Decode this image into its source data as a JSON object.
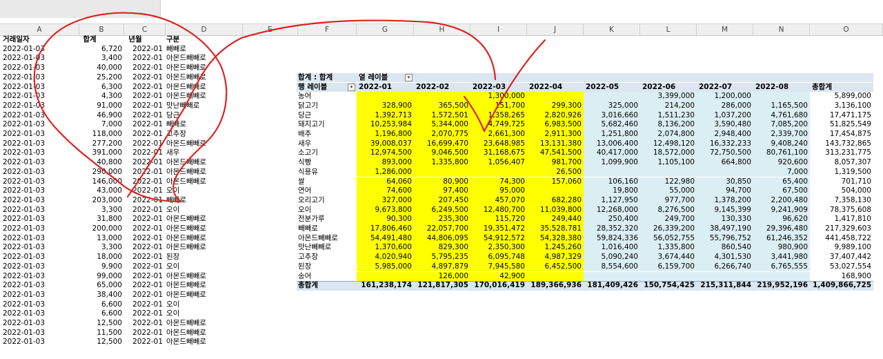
{
  "columns": [
    "A",
    "B",
    "C",
    "D",
    "E",
    "F",
    "G",
    "H",
    "I",
    "J",
    "K",
    "L",
    "M",
    "N",
    "O"
  ],
  "source": {
    "headers": [
      "거래일자",
      "합계",
      "년월",
      "구분"
    ],
    "rows": [
      [
        "2022-01-03",
        "6,720",
        "2022-01",
        "빼빼로"
      ],
      [
        "2022-01-03",
        "3,400",
        "2022-01",
        "아몬드빼빼로"
      ],
      [
        "2022-01-03",
        "40,000",
        "2022-01",
        "아몬드빼빼로"
      ],
      [
        "2022-01-03",
        "25,200",
        "2022-01",
        "아몬드빼빼로"
      ],
      [
        "2022-01-03",
        "6,300",
        "2022-01",
        "아몬드빼빼로"
      ],
      [
        "2022-01-03",
        "4,300",
        "2022-01",
        "아몬드빼빼로"
      ],
      [
        "2022-01-03",
        "91,000",
        "2022-01",
        "맛난빼빼로"
      ],
      [
        "2022-01-03",
        "46,900",
        "2022-01",
        "당근"
      ],
      [
        "2022-01-03",
        "7,000",
        "2022-01",
        "빼빼로"
      ],
      [
        "2022-01-03",
        "118,000",
        "2022-01",
        "고추장"
      ],
      [
        "2022-01-03",
        "277,200",
        "2022-01",
        "아몬드빼빼로"
      ],
      [
        "2022-01-03",
        "391,000",
        "2022-01",
        "새우"
      ],
      [
        "2022-01-03",
        "40,800",
        "2022-01",
        "아몬드빼빼로"
      ],
      [
        "2022-01-03",
        "290,000",
        "2022-01",
        "아몬드빼빼로"
      ],
      [
        "2022-01-03",
        "146,000",
        "2022-01",
        "아몬드빼빼로"
      ],
      [
        "2022-01-03",
        "43,000",
        "2022-01",
        "오이"
      ],
      [
        "2022-01-03",
        "203,000",
        "2022-01",
        "빼빼로"
      ],
      [
        "2022-01-03",
        "3,300",
        "2022-01",
        "오이"
      ],
      [
        "2022-01-03",
        "31,800",
        "2022-01",
        "아몬드빼빼로"
      ],
      [
        "2022-01-03",
        "200,000",
        "2022-01",
        "아몬드빼빼로"
      ],
      [
        "2022-01-03",
        "13,000",
        "2022-01",
        "아몬드빼빼로"
      ],
      [
        "2022-01-03",
        "3,300",
        "2022-01",
        "아몬드빼빼로"
      ],
      [
        "2022-01-03",
        "18,000",
        "2022-01",
        "된장"
      ],
      [
        "2022-01-03",
        "9,900",
        "2022-01",
        "오이"
      ],
      [
        "2022-01-03",
        "99,000",
        "2022-01",
        "아몬드빼빼로"
      ],
      [
        "2022-01-03",
        "65,000",
        "2022-01",
        "아몬드빼빼로"
      ],
      [
        "2022-01-03",
        "38,400",
        "2022-01",
        "아몬드빼빼로"
      ],
      [
        "2022-01-03",
        "6,600",
        "2022-01",
        "오이"
      ],
      [
        "2022-01-03",
        "6,600",
        "2022-01",
        "오이"
      ],
      [
        "2022-01-03",
        "12,500",
        "2022-01",
        "아몬드빼빼로"
      ],
      [
        "2022-01-03",
        "11,500",
        "2022-01",
        "아몬드빼빼로"
      ],
      [
        "2022-01-03",
        "12,500",
        "2022-01",
        "아몬드빼빼로"
      ]
    ]
  },
  "pivot": {
    "value_label": "합계 : 합계",
    "column_label": "열 레이블",
    "row_label": "행 레이블",
    "months": [
      "2022-01",
      "2022-02",
      "2022-03",
      "2022-04",
      "2022-05",
      "2022-06",
      "2022-07",
      "2022-08"
    ],
    "total_label": "총합계",
    "rows": [
      {
        "name": "농어",
        "values": [
          "",
          "",
          "1,300,000",
          "",
          "",
          "3,399,000",
          "1,200,000",
          ""
        ],
        "total": "5,899,000"
      },
      {
        "name": "닭고기",
        "values": [
          "328,900",
          "365,500",
          "151,700",
          "299,300",
          "325,000",
          "214,200",
          "286,000",
          "1,165,500"
        ],
        "total": "3,136,100"
      },
      {
        "name": "당근",
        "values": [
          "1,392,713",
          "1,572,501",
          "1,358,265",
          "2,820,926",
          "3,016,660",
          "1,511,230",
          "1,037,200",
          "4,761,680"
        ],
        "total": "17,471,175"
      },
      {
        "name": "돼지고기",
        "values": [
          "10,253,984",
          "5,344,000",
          "4,749,725",
          "6,983,500",
          "5,682,460",
          "8,136,200",
          "3,590,480",
          "7,085,200"
        ],
        "total": "51,825,549"
      },
      {
        "name": "배추",
        "values": [
          "1,196,800",
          "2,070,775",
          "2,661,300",
          "2,911,300",
          "1,251,800",
          "2,074,800",
          "2,948,400",
          "2,339,700"
        ],
        "total": "17,454,875"
      },
      {
        "name": "새우",
        "values": [
          "39,008,037",
          "16,699,470",
          "23,648,985",
          "13,131,380",
          "13,006,400",
          "12,498,120",
          "16,332,233",
          "9,408,240"
        ],
        "total": "143,732,865"
      },
      {
        "name": "소고기",
        "values": [
          "12,974,500",
          "9,046,500",
          "31,168,675",
          "47,541,500",
          "40,417,000",
          "18,572,000",
          "72,750,500",
          "80,761,100"
        ],
        "total": "313,231,775"
      },
      {
        "name": "식빵",
        "values": [
          "893,000",
          "1,335,800",
          "1,056,407",
          "981,700",
          "1,099,900",
          "1,105,100",
          "664,800",
          "920,600"
        ],
        "total": "8,057,307"
      },
      {
        "name": "식용유",
        "values": [
          "1,286,000",
          "",
          "",
          "26,500",
          "",
          "",
          "",
          "7,000"
        ],
        "total": "1,319,500"
      },
      {
        "name": "쌀",
        "values": [
          "64,060",
          "80,900",
          "74,300",
          "157,060",
          "106,160",
          "122,980",
          "30,850",
          "65,400"
        ],
        "total": "701,710"
      },
      {
        "name": "연어",
        "values": [
          "74,600",
          "97,400",
          "95,000",
          "",
          "19,800",
          "55,000",
          "94,700",
          "67,500"
        ],
        "total": "504,000"
      },
      {
        "name": "오리고기",
        "values": [
          "327,000",
          "207,450",
          "457,070",
          "682,280",
          "1,127,950",
          "977,700",
          "1,378,200",
          "2,200,480"
        ],
        "total": "7,358,130"
      },
      {
        "name": "오이",
        "values": [
          "9,673,800",
          "6,249,500",
          "12,480,700",
          "11,039,800",
          "12,268,000",
          "8,276,500",
          "9,145,399",
          "9,241,909"
        ],
        "total": "78,375,608"
      },
      {
        "name": "전분가루",
        "values": [
          "90,300",
          "235,300",
          "115,720",
          "249,440",
          "250,400",
          "249,700",
          "130,330",
          "96,620"
        ],
        "total": "1,417,810"
      },
      {
        "name": "빼빼로",
        "values": [
          "17,806,460",
          "22,057,700",
          "19,351,472",
          "35,528,781",
          "28,352,320",
          "26,339,200",
          "38,497,190",
          "29,396,480"
        ],
        "total": "217,329,603"
      },
      {
        "name": "아몬드빼빼로",
        "values": [
          "54,491,480",
          "44,806,095",
          "54,912,572",
          "54,328,380",
          "59,824,336",
          "56,052,755",
          "55,796,752",
          "61,246,352"
        ],
        "total": "441,458,722"
      },
      {
        "name": "맛난빼빼로",
        "values": [
          "1,370,600",
          "829,300",
          "2,350,300",
          "1,245,260",
          "1,016,400",
          "1,335,800",
          "860,540",
          "980,900"
        ],
        "total": "9,989,100"
      },
      {
        "name": "고추장",
        "values": [
          "4,020,940",
          "5,795,235",
          "6,095,748",
          "4,987,329",
          "5,090,240",
          "3,674,440",
          "4,301,530",
          "3,441,980"
        ],
        "total": "37,407,442"
      },
      {
        "name": "된장",
        "values": [
          "5,985,000",
          "4,897,879",
          "7,945,580",
          "6,452,500",
          "8,554,600",
          "6,159,700",
          "6,266,740",
          "6,765,555"
        ],
        "total": "53,027,554"
      },
      {
        "name": "송어",
        "values": [
          "",
          "126,000",
          "42,900",
          "",
          "",
          "",
          "",
          ""
        ],
        "total": "168,900"
      }
    ],
    "grand_total": {
      "name": "총합계",
      "values": [
        "161,238,174",
        "121,817,305",
        "170,016,419",
        "189,366,936",
        "181,409,426",
        "150,754,425",
        "215,311,844",
        "219,952,196"
      ],
      "total": "1,409,866,725"
    }
  },
  "colors": {
    "highlight_yellow": "#ffff00",
    "highlight_blue": "#dbeef3",
    "pivot_header": "#dbe6f1",
    "annotation_red": "#e02020"
  }
}
